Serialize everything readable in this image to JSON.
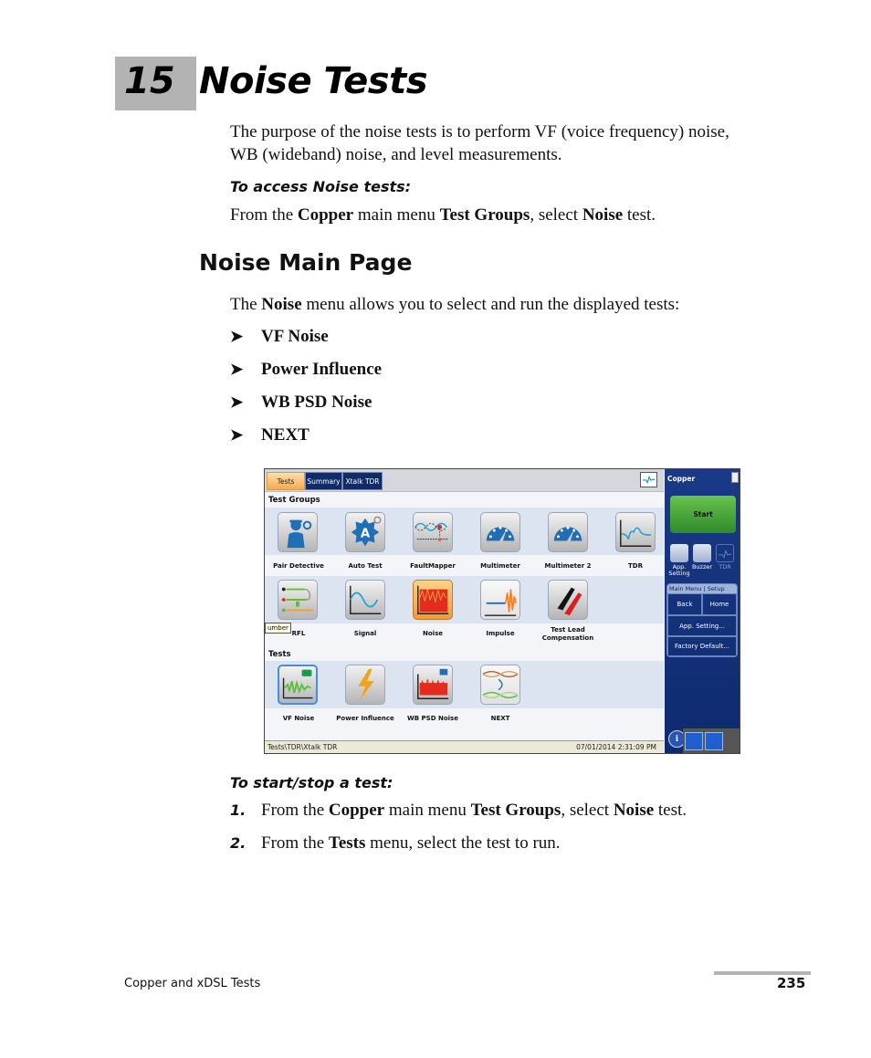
{
  "chapter": {
    "number": "15",
    "title": "Noise Tests"
  },
  "intro": {
    "line1": "The purpose of the noise tests is to perform VF (voice frequency) noise,",
    "line2": "WB (wideband) noise, and level measurements."
  },
  "access": {
    "heading": "To access Noise tests:",
    "parts": [
      "From the ",
      "Copper",
      " main menu ",
      "Test Groups",
      ", select ",
      "Noise",
      " test."
    ]
  },
  "section": {
    "title": "Noise Main Page",
    "intro_parts": [
      "The ",
      "Noise",
      " menu allows you to select and run the displayed tests:"
    ],
    "bullet_glyph": "➤",
    "bullets": [
      "VF Noise",
      "Power Influence",
      "WB PSD Noise",
      "NEXT"
    ]
  },
  "screenshot": {
    "tabs": [
      "Tests",
      "Summary",
      "Xtalk TDR"
    ],
    "active_tab": "Tests",
    "test_groups_label": "Test Groups",
    "test_groups_row1": [
      "Pair Detective",
      "Auto Test",
      "FaultMapper",
      "Multimeter",
      "Multimeter 2",
      "TDR"
    ],
    "test_groups_row2": [
      "RFL",
      "Signal",
      "Noise",
      "Impulse",
      "Test Lead Compensation"
    ],
    "selected_group": "Noise",
    "tooltip": "umber",
    "tests_label": "Tests",
    "tests": [
      "VF Noise",
      "Power Influence",
      "WB PSD Noise",
      "NEXT"
    ],
    "selected_test": "VF Noise",
    "status_path": "Tests\\TDR\\Xtalk TDR",
    "status_datetime": "07/01/2014 2:31:09 PM",
    "side_panel": {
      "title": "Copper",
      "start_label": "Start",
      "quick_icons": [
        "App. Setting",
        "Buzzer",
        "TDR"
      ],
      "menu_header": "Main Menu | Setup",
      "back_label": "Back",
      "home_label": "Home",
      "app_setting_label": "App. Setting...",
      "factory_default_label": "Factory Default..."
    }
  },
  "start_stop": {
    "heading": "To start/stop a test:",
    "steps": [
      {
        "num": "1.",
        "parts": [
          "From the ",
          "Copper",
          " main menu ",
          "Test Groups",
          ", select ",
          "Noise",
          " test."
        ]
      },
      {
        "num": "2.",
        "parts": [
          "From the ",
          "Tests",
          " menu, select the test to run."
        ]
      }
    ]
  },
  "footer": {
    "left": "Copper and xDSL Tests",
    "page": "235"
  }
}
